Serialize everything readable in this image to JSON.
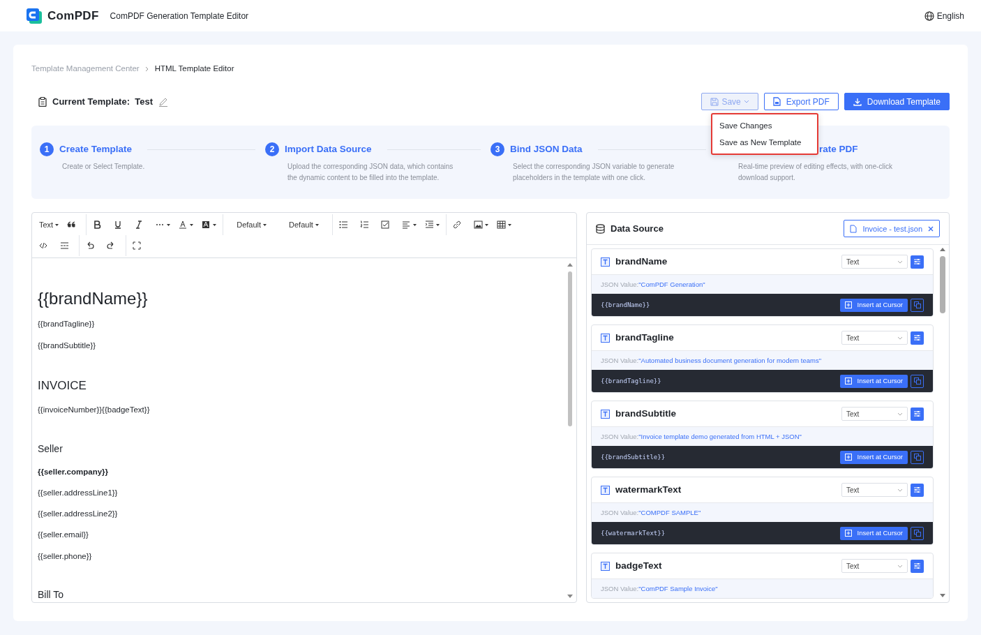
{
  "header": {
    "logo_text": "ComPDF",
    "app_title": "ComPDF Generation Template Editor",
    "language": "English"
  },
  "breadcrumb": [
    {
      "label": "Template Management Center",
      "current": false
    },
    {
      "label": "HTML Template Editor",
      "current": true
    }
  ],
  "template": {
    "label": "Current Template:",
    "name": "Test"
  },
  "actions": {
    "save": "Save",
    "export": "Export PDF",
    "download": "Download Template"
  },
  "save_menu": {
    "expanded": true,
    "items": [
      "Save Changes",
      "Save as New Template"
    ]
  },
  "steps": [
    {
      "number": "1",
      "title": "Create Template",
      "description": "Create or Select Template."
    },
    {
      "number": "2",
      "title": "Import Data Source",
      "description": "Upload the corresponding JSON data, which contains the dynamic content to be filled into the template."
    },
    {
      "number": "3",
      "title": "Bind JSON Data",
      "description": "Select the corresponding JSON variable to generate placeholders in the template with one click."
    },
    {
      "title": "rate PDF",
      "description": "Real-time preview of editing effects, with one-click download support."
    }
  ],
  "toolbar": {
    "block_format": "Text",
    "font_family": "Default",
    "font_size": "Default"
  },
  "editor_content": [
    {
      "kind": "h1",
      "text": "{{brandName}}"
    },
    {
      "kind": "p",
      "text": "{{brandTagline}}"
    },
    {
      "kind": "p",
      "text": "{{brandSubtitle}}"
    },
    {
      "kind": "h2",
      "text": "INVOICE"
    },
    {
      "kind": "p",
      "text": "{{invoiceNumber}}{{badgeText}}"
    },
    {
      "kind": "h3",
      "text": "Seller"
    },
    {
      "kind": "pb",
      "text": "{{seller.company}}"
    },
    {
      "kind": "p",
      "text": "{{seller.addressLine1}}"
    },
    {
      "kind": "p",
      "text": "{{seller.addressLine2}}"
    },
    {
      "kind": "p",
      "text": "{{seller.email}}"
    },
    {
      "kind": "p",
      "text": "{{seller.phone}}"
    },
    {
      "kind": "h3",
      "text": "Bill To"
    }
  ],
  "data_source": {
    "title": "Data Source",
    "file": "Invoice - test.json",
    "fields": [
      {
        "name": "brandName",
        "type": "Text",
        "value_label": "JSON Value:",
        "value": "\"ComPDF Generation\"",
        "placeholder": "{{brandName}}",
        "insert": "Insert at Cursor"
      },
      {
        "name": "brandTagline",
        "type": "Text",
        "value_label": "JSON Value:",
        "value": "\"Automated business document generation for modern teams\"",
        "placeholder": "{{brandTagline}}",
        "insert": "Insert at Cursor"
      },
      {
        "name": "brandSubtitle",
        "type": "Text",
        "value_label": "JSON Value:",
        "value": "\"Invoice template demo generated from HTML + JSON\"",
        "placeholder": "{{brandSubtitle}}",
        "insert": "Insert at Cursor"
      },
      {
        "name": "watermarkText",
        "type": "Text",
        "value_label": "JSON Value:",
        "value": "\"COMPDF SAMPLE\"",
        "placeholder": "{{watermarkText}}",
        "insert": "Insert at Cursor"
      },
      {
        "name": "badgeText",
        "type": "Text",
        "value_label": "JSON Value:",
        "value": "\"ComPDF Sample Invoice\""
      }
    ]
  }
}
